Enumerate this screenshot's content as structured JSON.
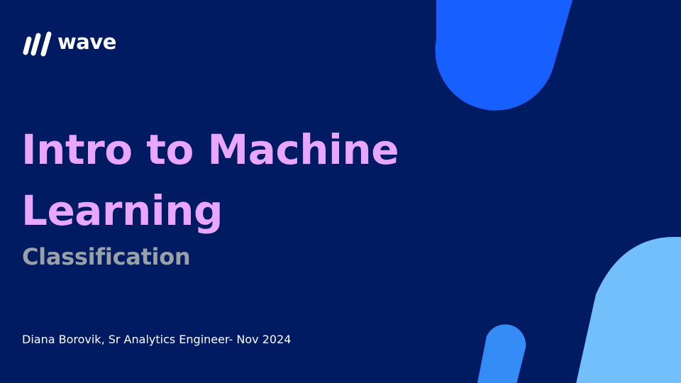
{
  "brand": {
    "logo_text": "wave",
    "logo_icon": "wave-stripes-icon"
  },
  "slide": {
    "title_line1": "Intro to Machine",
    "title_line2": "Learning",
    "subtitle": "Classification",
    "byline": "Diana Borovik, Sr Analytics Engineer- Nov 2024"
  },
  "colors": {
    "background": "#011b63",
    "title": "#e9a6ff",
    "subtitle": "#9aa0a8",
    "byline": "#ffffff",
    "shape_blue": "#1760ff",
    "shape_light_blue": "#73bffc",
    "shape_mid_blue": "#368cf7"
  }
}
